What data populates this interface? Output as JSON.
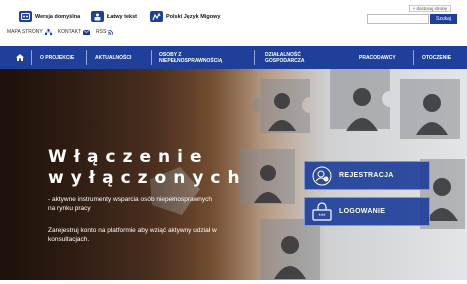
{
  "header": {
    "versions": [
      {
        "label": "Wersja domyślna",
        "icon": "default-version-icon"
      },
      {
        "label": "Łatwy tekst",
        "icon": "easy-text-icon"
      },
      {
        "label": "Polski Język Migowy",
        "icon": "sign-language-icon"
      }
    ],
    "access_label": "+ dostosuj stronę",
    "search": {
      "placeholder": "",
      "button": "Szukaj"
    },
    "utility": {
      "sitemap": "MAPA STRONY",
      "contact": "KONTAKT",
      "rss": "RSS"
    }
  },
  "nav": {
    "home_icon": "home-icon",
    "items": [
      "O PROJEKCIE",
      "AKTUALNOŚCI",
      "OSOBY Z NIEPEŁNOSPRAWNOŚCIĄ",
      "DZIAŁALNOŚĆ GOSPODARCZA",
      "PRACODAWCY",
      "OTOCZENIE"
    ]
  },
  "hero": {
    "title_line1": "Włączenie",
    "title_line2": "wyłączonych",
    "subtitle": "- aktywne instrumenty wsparcia osób niepełnosprawnych na rynku pracy",
    "cta": "Zarejestruj konto na platformie aby wziąć aktywny udział w konsultacjach.",
    "buttons": [
      {
        "label": "REJESTRACJA",
        "icon": "register-user-icon"
      },
      {
        "label": "LOGOWANIE",
        "icon": "login-lock-icon"
      }
    ]
  },
  "colors": {
    "brand": "#1e3f9a",
    "white": "#ffffff"
  }
}
